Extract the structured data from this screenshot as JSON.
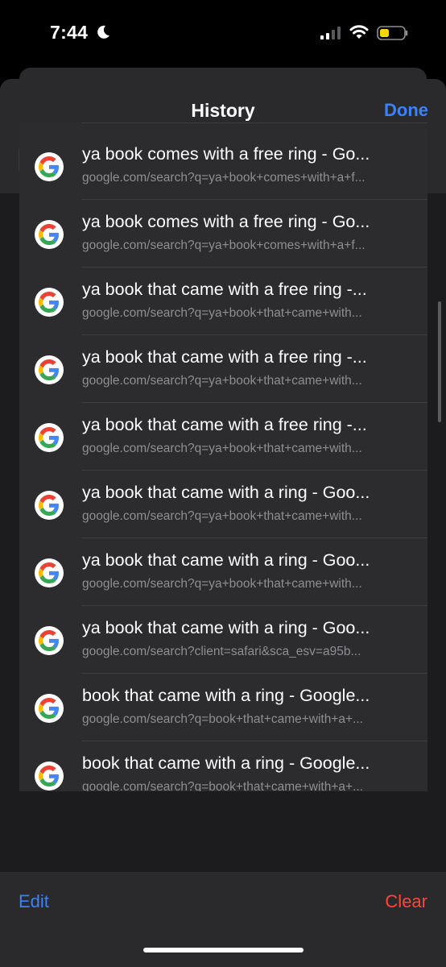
{
  "status_bar": {
    "time": "7:44",
    "battery_color": "#f5d60a"
  },
  "header": {
    "title": "History",
    "done_label": "Done"
  },
  "segments": [
    {
      "icon": "book-icon",
      "selected": false
    },
    {
      "icon": "reading-glasses-icon",
      "selected": false
    },
    {
      "icon": "clock-icon",
      "selected": true
    }
  ],
  "history": [
    {
      "title": "ya book comes with a free ring - Go...",
      "url": "google.com/search?q=ya+book+comes+with+a+f..."
    },
    {
      "title": "ya book comes with a free ring - Go...",
      "url": "google.com/search?q=ya+book+comes+with+a+f..."
    },
    {
      "title": "ya book that came with a free ring -...",
      "url": "google.com/search?q=ya+book+that+came+with..."
    },
    {
      "title": "ya book that came with a free ring -...",
      "url": "google.com/search?q=ya+book+that+came+with..."
    },
    {
      "title": "ya book that came with a free ring -...",
      "url": "google.com/search?q=ya+book+that+came+with..."
    },
    {
      "title": "ya book that came with a ring - Goo...",
      "url": "google.com/search?q=ya+book+that+came+with..."
    },
    {
      "title": "ya book that came with a ring - Goo...",
      "url": "google.com/search?q=ya+book+that+came+with..."
    },
    {
      "title": "ya book that came with a ring - Goo...",
      "url": "google.com/search?client=safari&sca_esv=a95b..."
    },
    {
      "title": "book that came with a ring - Google...",
      "url": "google.com/search?q=book+that+came+with+a+..."
    },
    {
      "title": "book that came with a ring - Google...",
      "url": "google.com/search?q=book+that+came+with+a+..."
    }
  ],
  "toolbar": {
    "edit_label": "Edit",
    "clear_label": "Clear"
  },
  "colors": {
    "accent": "#3a82f7",
    "destructive": "#ff453a"
  }
}
